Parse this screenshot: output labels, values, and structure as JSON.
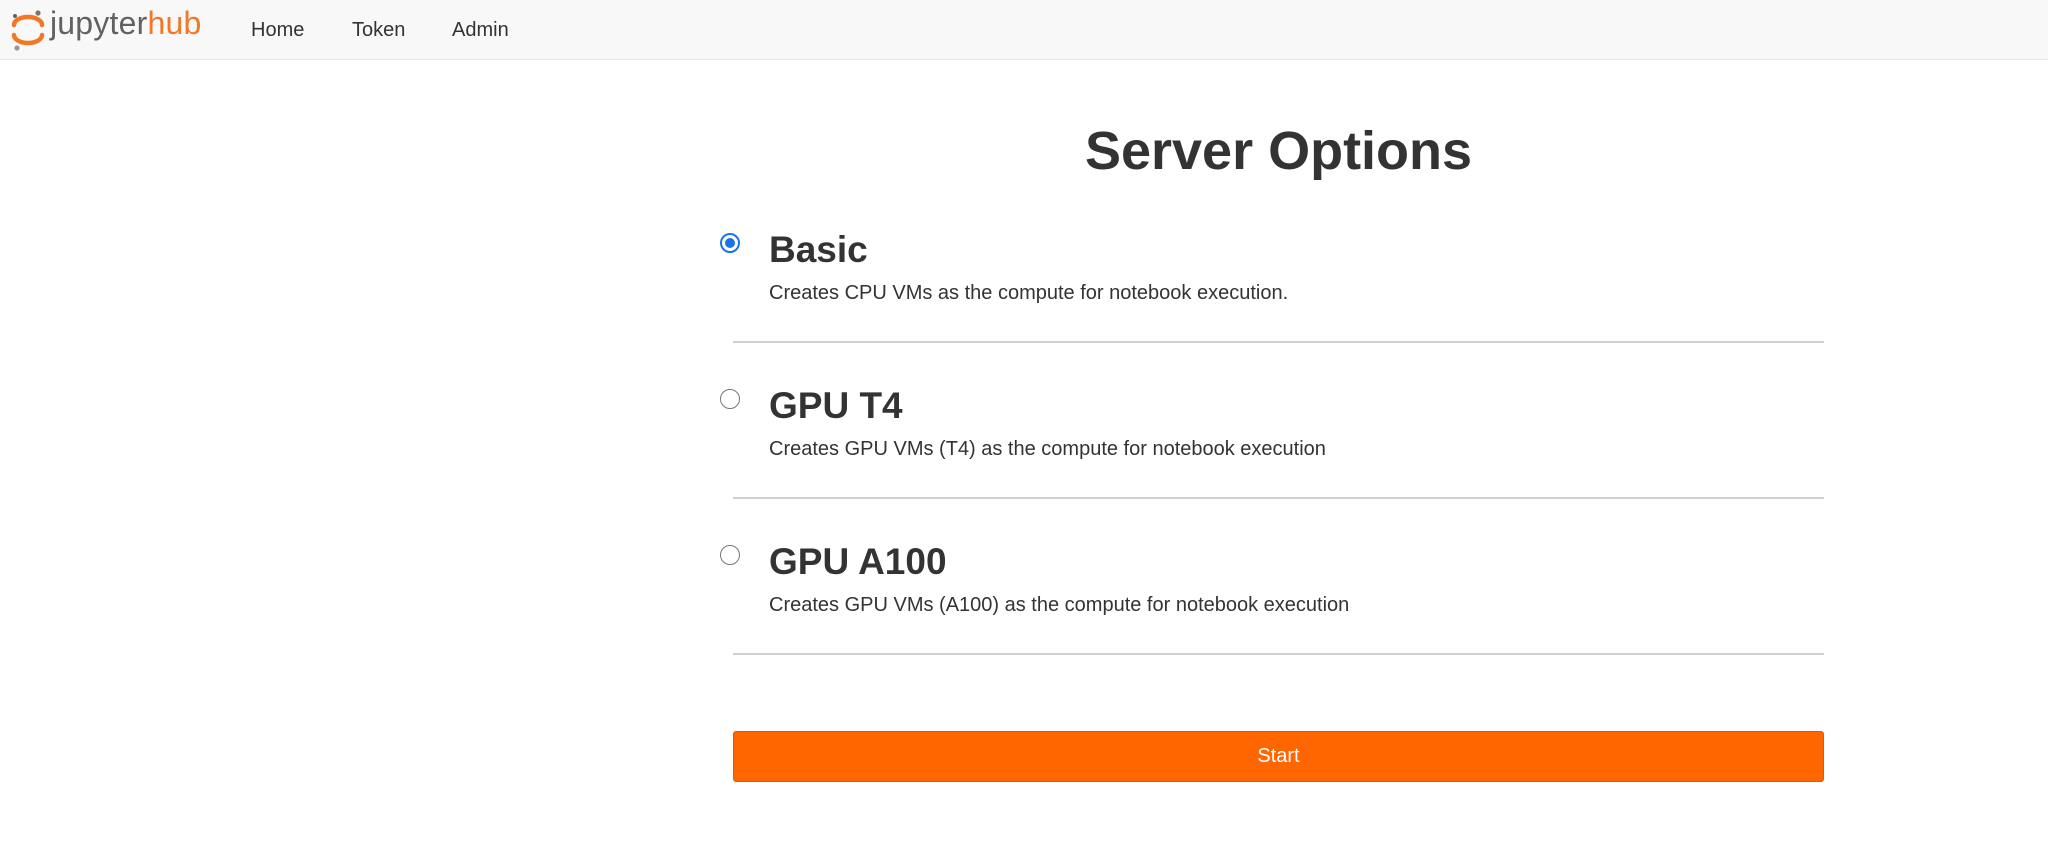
{
  "app": {
    "brand_part1": "jupyter",
    "brand_part2": "hub",
    "brand_colors": {
      "orange": "#f37726",
      "gray": "#616161"
    }
  },
  "nav": {
    "items": [
      {
        "label": "Home"
      },
      {
        "label": "Token"
      },
      {
        "label": "Admin"
      }
    ]
  },
  "main": {
    "title": "Server Options",
    "options": [
      {
        "title": "Basic",
        "description": "Creates CPU VMs as the compute for notebook execution.",
        "selected": true
      },
      {
        "title": "GPU T4",
        "description": "Creates GPU VMs (T4) as the compute for notebook execution",
        "selected": false
      },
      {
        "title": "GPU A100",
        "description": "Creates GPU VMs (A100) as the compute for notebook execution",
        "selected": false
      }
    ],
    "start_label": "Start",
    "accent_color": "#ff6600",
    "radio_selected_color": "#1a73e8"
  }
}
